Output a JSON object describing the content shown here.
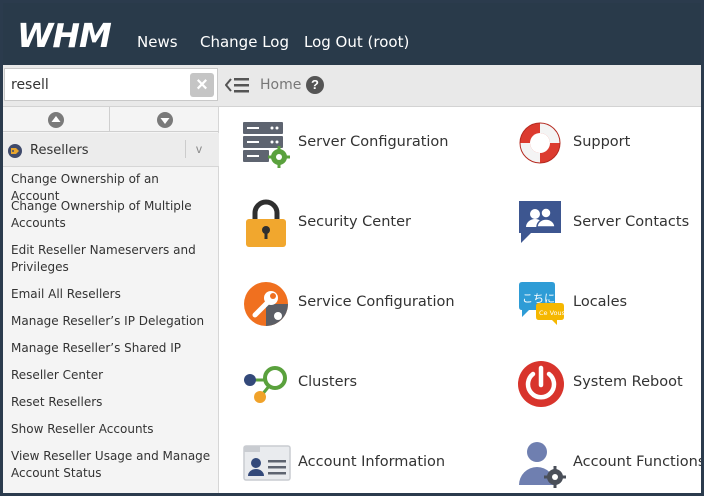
{
  "header": {
    "logo_text": "WHM",
    "nav": [
      {
        "label": "News"
      },
      {
        "label": "Change Log"
      },
      {
        "label": "Log Out (root)"
      }
    ]
  },
  "search": {
    "value": "resell",
    "clear_icon": "close-icon"
  },
  "breadcrumb": {
    "home": "Home",
    "help_icon": "help-icon"
  },
  "sidebar": {
    "group_label": "Resellers",
    "group_toggle": "v",
    "items": [
      "Change Ownership of an Account",
      "Change Ownership of Multiple Accounts",
      "Edit Reseller Nameservers and Privileges",
      "Email All Resellers",
      "Manage Reseller’s IP Delegation",
      "Manage Reseller’s Shared IP",
      "Reseller Center",
      "Reset Resellers",
      "Show Reseller Accounts",
      "View Reseller Usage and Manage Account Status"
    ]
  },
  "tiles": [
    {
      "label": "Server Configuration",
      "icon": "server-config-icon"
    },
    {
      "label": "Support",
      "icon": "lifebuoy-icon"
    },
    {
      "label": "Security Center",
      "icon": "padlock-icon"
    },
    {
      "label": "Server Contacts",
      "icon": "contacts-icon"
    },
    {
      "label": "Service Configuration",
      "icon": "wrench-gear-icon"
    },
    {
      "label": "Locales",
      "icon": "locales-icon",
      "badge_text": "こちに",
      "badge_sub": "Ce Vous"
    },
    {
      "label": "Clusters",
      "icon": "clusters-icon"
    },
    {
      "label": "System Reboot",
      "icon": "power-icon"
    },
    {
      "label": "Account Information",
      "icon": "id-card-icon"
    },
    {
      "label": "Account Functions",
      "icon": "user-gear-icon"
    }
  ],
  "colors": {
    "topbar": "#293a4a",
    "accent_orange": "#f08a24",
    "lock_yellow": "#f1a72e",
    "contacts_blue": "#3d5690",
    "power_red": "#d8342c",
    "gear_green": "#5aa13d"
  }
}
